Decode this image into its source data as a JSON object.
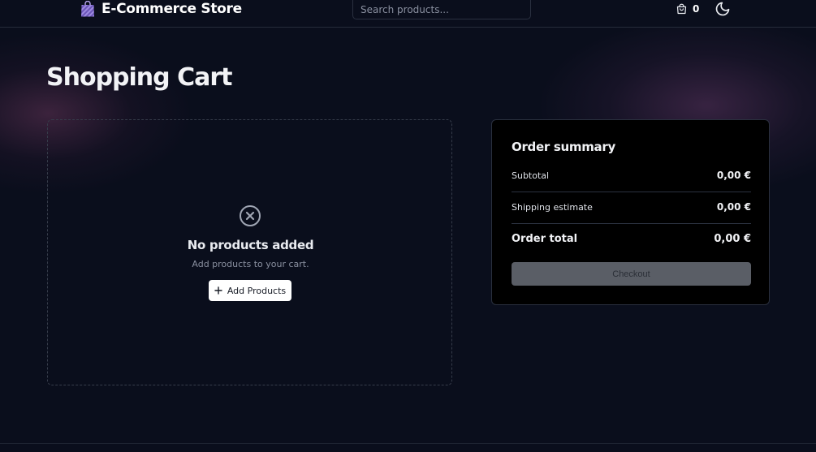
{
  "header": {
    "brand_name": "E-Commerce Store",
    "brand_icon": "shopping-bag-icon",
    "search_placeholder": "Search products...",
    "cart_count": "0",
    "cart_icon": "shopping-bag-outline-icon",
    "theme_icon": "moon-icon"
  },
  "main": {
    "title": "Shopping Cart"
  },
  "empty_cart": {
    "icon": "circle-x-icon",
    "title": "No products added",
    "subtitle": "Add products to your cart.",
    "button_icon": "plus-icon",
    "button_label": "Add Products"
  },
  "summary": {
    "title": "Order summary",
    "subtotal_label": "Subtotal",
    "subtotal_value": "0,00 €",
    "shipping_label": "Shipping estimate",
    "shipping_value": "0,00 €",
    "total_label": "Order total",
    "total_value": "0,00 €",
    "checkout_label": "Checkout"
  },
  "colors": {
    "background": "#0a0e1c",
    "panel": "#000000",
    "checkout_button": "#5a5e66",
    "accent_glow": "#7a4a7a"
  }
}
